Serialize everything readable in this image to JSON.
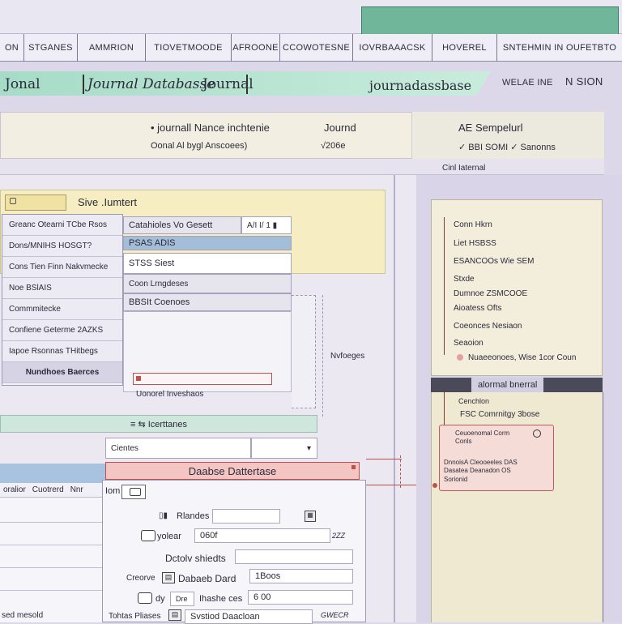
{
  "corner_tab": {
    "color": "#6fb69a"
  },
  "menu": {
    "items": [
      "ON",
      "STGANES",
      "AMMRION",
      "TIOVETMOODE",
      "AFROONE",
      "CCOWOTESNE",
      "IOVRBAAACSK",
      "HOVEREL",
      "SNTEHMIN IN OUFETBTO"
    ]
  },
  "ribbon": {
    "left_label": "Jonal",
    "title": "Journal Databasse",
    "mid_label": "Journal",
    "right_label": "journadassbase",
    "right_small_1": "WELAE INE",
    "right_small_2": "N SION"
  },
  "header": {
    "title": "• journall Nance inchtenie",
    "subtitle": "Oonal Al bygl Anscoees)",
    "col2_title": "Journd",
    "col2_sub": "√206e",
    "col3_title": "AE Sempelurl",
    "col3_sub": "✓ BBI SOMI ✓ Sanonns",
    "strip_label": "Cinl Iaternal"
  },
  "left": {
    "yellow_title": "Sive .Iumtert",
    "list_items": [
      "Greanc Otearni TCbe Rsos",
      "Dons/MNIHS HOSGT?",
      "Cons Tien Finn Nakvmecke",
      "Noe BSlAIS",
      "Commmitecke",
      "Confiene Geterme 2AZKS",
      "Iapoe Rsonnas THitbegs",
      "Nundhoes Baerces"
    ],
    "list_selected_index": 7,
    "fields": {
      "f1": "Catahioles  Vo Gesett",
      "f1_badge": "A/I I/ 1 ▮",
      "f2": "PSAS ADIS",
      "f3": "STSS Siest",
      "f4": "Coon Lrngdeses",
      "f5": "BBSIt   Coenoes"
    },
    "side_label": "Nvfoeges",
    "red_box_label": "Uonorel Inveshaos",
    "green_sep": "≡ ⇆ Icerttanes",
    "dropdown": "Cientes",
    "db_title": "Daabse Dattertase",
    "blue_bar_labels": [
      "oralior",
      "Cuotrerd",
      "Nnr"
    ],
    "left_strip": "sed mesold"
  },
  "form": {
    "title": "Iom",
    "rows": [
      {
        "label": "Rlandes",
        "value": "",
        "icon": "chart-icon"
      },
      {
        "label": "yolear",
        "value": "060f",
        "badge": "2ZZ"
      },
      {
        "label": "Dctolv shiedts",
        "value": ""
      },
      {
        "label": "Dabaeb Dard",
        "value": "1Boos",
        "prefix": "Creorve"
      },
      {
        "label": "Ihashe ces",
        "value": "6 00",
        "prefix": "Dre"
      },
      {
        "label": "Svstiod Daacloan",
        "value": "",
        "prefix": "Tohtas Pliases",
        "badge": "GWECR"
      }
    ]
  },
  "right": {
    "tree": [
      "Conn Hkrn",
      "Liet HSBSS",
      "ESANCOOs Wie SEM",
      "Stxde",
      "Dumnoe ZSMCOOE",
      "Aioatess Ofts",
      "Coeonces Nesiaon",
      "Seaoion",
      "Nuaeeonoes, Wise  1cor  Coun"
    ],
    "dark_bar_label": "alormal bnerral",
    "lower_label_1": "Cenchlon",
    "lower_label_2": "FSC Comrnitgy 3bose",
    "callout": {
      "title": "Ceuoenomal Corm",
      "sub": "Conls",
      "body_1": "DnnoisA Cleooeeles DAS",
      "body_2": "Dasatea Deanadon OS",
      "body_3": "Sorionid"
    }
  }
}
